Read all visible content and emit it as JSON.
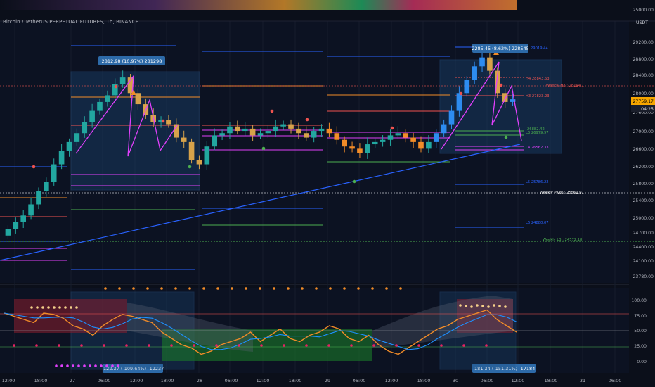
{
  "header": {
    "symbol": "Bitcoin / TetherUS PERPETUAL FUTURES, 1h, BINANCE"
  },
  "price_axis": {
    "currency": "USDT",
    "ticks": [
      "25000.00",
      "29200.00",
      "28800.00",
      "28400.00",
      "28000.00",
      "27600.00",
      "27000.00",
      "26600.00",
      "26200.00",
      "25800.00",
      "25400.00",
      "25000.00",
      "24700.00",
      "24400.00",
      "24100.00",
      "23780.00"
    ],
    "last_price": "27759.17",
    "countdown": "04:25"
  },
  "osc_axis": {
    "ticks": [
      "100.00",
      "75.00",
      "50.00",
      "25.00",
      "0.00"
    ]
  },
  "time_axis": {
    "ticks": [
      "12:00",
      "18:00",
      "27",
      "06:00",
      "12:00",
      "18:00",
      "28",
      "06:00",
      "12:00",
      "18:00",
      "29",
      "06:00",
      "12:00",
      "18:00",
      "30",
      "06:00",
      "12:00",
      "18:00",
      "31",
      "06:00"
    ]
  },
  "measure_labels": {
    "top_left": "2812.98 (10.97%) 281298",
    "top_right": "2285.45 (8.62%) 228545",
    "bottom_left": "-122.37 (-109.64%) -12237",
    "bottom_right": "-181.34 (-151.31%) -17184"
  },
  "level_labels": {
    "r_top": "29019.44",
    "h4": "H4 28843.63",
    "weekly_h3": "Weekly H3 : 28194.1",
    "h3": "H3 27823.23",
    "l3": "L3 26979.97",
    "l3b": "26882.42",
    "l4": "L4 26562.33",
    "l5": "L5 25786.22",
    "weekly_pivot": "Weekly Pivot : 25561.91",
    "l6": "L6 24880.07",
    "weekly_l3": "Weekly L3 : 24572.18"
  },
  "colors": {
    "background": "#0b0f1a",
    "up_candle": "#22a7a0",
    "down_candle": "#d7a24a",
    "orange_candle": "#f28c28",
    "magenta": "#e040fb",
    "blue_line": "#2962ff",
    "measure_box": "#1e4f80",
    "oscillator_line": "#f28c28",
    "oscillator_signal": "#1e90ff",
    "price_tag": "#f7a600"
  },
  "chart_data": {
    "type": "candlestick",
    "price_scale_note": "USDT",
    "ylim": [
      23780,
      29200
    ],
    "candles_close_approx": [
      24850,
      25000,
      25150,
      25400,
      25700,
      25900,
      26300,
      26600,
      26800,
      27000,
      27250,
      27500,
      27700,
      27850,
      28100,
      28250,
      27900,
      27650,
      27400,
      27250,
      27300,
      27200,
      26900,
      26800,
      26400,
      26300,
      26700,
      26950,
      27000,
      27150,
      27050,
      27100,
      26950,
      27000,
      27050,
      27150,
      27200,
      27100,
      27000,
      26900,
      27050,
      27100,
      27000,
      26850,
      26700,
      26650,
      26550,
      26750,
      26800,
      26850,
      26950,
      27000,
      26900,
      26800,
      26650,
      26800,
      27000,
      27200,
      27500,
      27900,
      28200,
      28500,
      28700,
      28400,
      27900,
      27700,
      27760
    ],
    "oscillator": {
      "ylim": [
        0,
        100
      ],
      "ticks": [
        100,
        75,
        50,
        25,
        0
      ],
      "values_approx": [
        80,
        75,
        70,
        65,
        80,
        78,
        72,
        60,
        55,
        45,
        60,
        70,
        78,
        75,
        70,
        65,
        50,
        40,
        30,
        25,
        15,
        20,
        30,
        35,
        40,
        50,
        35,
        45,
        55,
        40,
        35,
        45,
        50,
        60,
        55,
        40,
        35,
        45,
        30,
        20,
        15,
        25,
        35,
        45,
        55,
        60,
        70,
        75,
        80,
        85,
        70,
        60,
        50
      ]
    }
  }
}
